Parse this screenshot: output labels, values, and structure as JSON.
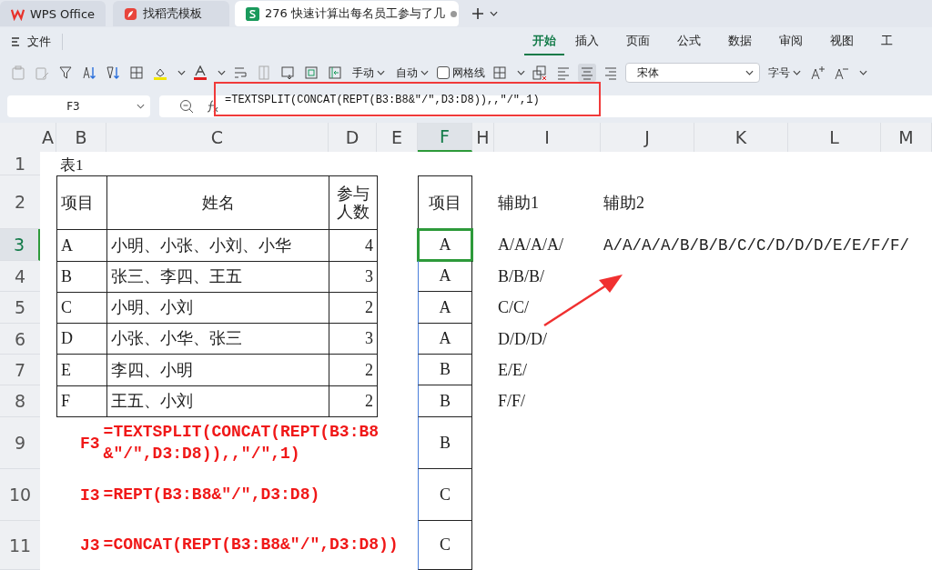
{
  "tabs": [
    {
      "label": "WPS Office",
      "kind": "wps",
      "selected": false,
      "unsaved": false
    },
    {
      "label": "找稻壳模板",
      "kind": "docer",
      "selected": false,
      "unsaved": false
    },
    {
      "label": "276 快速计算出每名员工参与了几",
      "kind": "sheet",
      "selected": true,
      "unsaved": true
    }
  ],
  "menu": {
    "file": "文件",
    "ribbon_tabs": [
      {
        "label": "开始",
        "selected": true
      },
      {
        "label": "插入",
        "selected": false
      },
      {
        "label": "页面",
        "selected": false
      },
      {
        "label": "公式",
        "selected": false
      },
      {
        "label": "数据",
        "selected": false
      },
      {
        "label": "审阅",
        "selected": false
      },
      {
        "label": "视图",
        "selected": false
      },
      {
        "label": "工",
        "selected": false
      }
    ]
  },
  "toolbar": {
    "row_height": "手动",
    "column_width": "自动",
    "gridlines": {
      "label": "网格线",
      "checked": false
    },
    "font": "宋体",
    "font_size": "字号"
  },
  "formula_bar": {
    "cell_ref": "F3",
    "formula": "=TEXTSPLIT(CONCAT(REPT(B3:B8&″/″,D3:D8)),,″/″,1)"
  },
  "sheet": {
    "columns": [
      {
        "label": "A",
        "selected": false
      },
      {
        "label": "B",
        "selected": false
      },
      {
        "label": "C",
        "selected": false
      },
      {
        "label": "D",
        "selected": false
      },
      {
        "label": "E",
        "selected": false
      },
      {
        "label": "F",
        "selected": true
      },
      {
        "label": "H",
        "selected": false
      },
      {
        "label": "I",
        "selected": false
      },
      {
        "label": "J",
        "selected": false
      },
      {
        "label": "K",
        "selected": false
      },
      {
        "label": "L",
        "selected": false
      },
      {
        "label": "M",
        "selected": false
      }
    ],
    "rows": [
      {
        "label": "1",
        "selected": false
      },
      {
        "label": "2",
        "selected": false
      },
      {
        "label": "3",
        "selected": true
      },
      {
        "label": "4",
        "selected": false
      },
      {
        "label": "5",
        "selected": false
      },
      {
        "label": "6",
        "selected": false
      },
      {
        "label": "7",
        "selected": false
      },
      {
        "label": "8",
        "selected": false
      },
      {
        "label": "9",
        "selected": false
      },
      {
        "label": "10",
        "selected": false
      },
      {
        "label": "11",
        "selected": false
      }
    ],
    "title": "表1",
    "table": {
      "headers": [
        "项目",
        "姓名",
        "参与人数"
      ],
      "rows": [
        [
          "A",
          "小明、小张、小刘、小华",
          "4"
        ],
        [
          "B",
          "张三、李四、王五",
          "3"
        ],
        [
          "C",
          "小明、小刘",
          "2"
        ],
        [
          "D",
          "小张、小华、张三",
          "3"
        ],
        [
          "E",
          "李四、小明",
          "2"
        ],
        [
          "F",
          "王五、小刘",
          "2"
        ]
      ]
    },
    "result": {
      "header": "项目",
      "values": [
        {
          "value": "A",
          "selected": true
        },
        {
          "value": "A",
          "selected": false
        },
        {
          "value": "A",
          "selected": false
        },
        {
          "value": "A",
          "selected": false
        },
        {
          "value": "B",
          "selected": false
        },
        {
          "value": "B",
          "selected": false
        },
        {
          "value": "B",
          "selected": false
        },
        {
          "value": "C",
          "selected": false
        },
        {
          "value": "C",
          "selected": false
        }
      ]
    },
    "helper1": {
      "header": "辅助1",
      "values": [
        "A/A/A/A/",
        "B/B/B/",
        "C/C/",
        "D/D/D/",
        "E/E/",
        "F/F/"
      ]
    },
    "helper2": {
      "header": "辅助2",
      "value": "A/A/A/A/B/B/B/C/C/D/D/D/E/E/F/F/"
    },
    "notes": [
      {
        "cell": "F3",
        "formula": "=TEXTSPLIT(CONCAT(REPT(B3:B8&″/″,D3:D8)),,″/″,1)"
      },
      {
        "cell": "I3",
        "formula": "=REPT(B3:B8&″/″,D3:D8)"
      },
      {
        "cell": "J3",
        "formula": "=CONCAT(REPT(B3:B8&″/″,D3:D8))"
      }
    ]
  }
}
